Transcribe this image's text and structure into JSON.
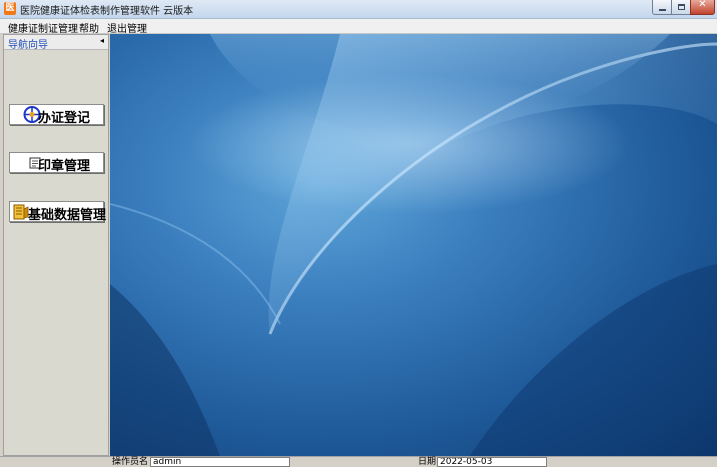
{
  "window": {
    "title": "医院健康证体检表制作管理软件 云版本",
    "app_icon_glyph": "医",
    "min_label": "",
    "max_label": "",
    "close_label": "✕"
  },
  "menu": {
    "items": [
      "健康证制证管理",
      "帮助",
      "退出管理"
    ]
  },
  "nav": {
    "title": "导航向导",
    "collapse_glyph": "◂",
    "buttons": [
      {
        "label": "办证登记",
        "icon": "register-icon"
      },
      {
        "label": "印章管理",
        "icon": "seal-icon"
      },
      {
        "label": "基础数据管理",
        "icon": "database-icon"
      }
    ]
  },
  "status": {
    "operator_label": "操作员名",
    "operator_value": "admin",
    "date_label": "日期",
    "date_value": "2022-05-03"
  },
  "colors": {
    "nav_title": "#1f4fb5",
    "desktop_dark": "#0f3b72",
    "desktop_light": "#5fa6d9"
  }
}
